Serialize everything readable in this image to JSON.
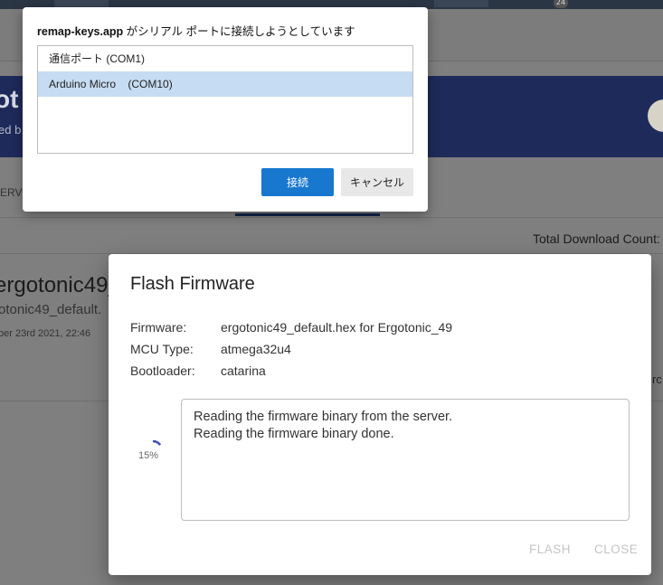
{
  "background": {
    "notification_count": "24",
    "banner_title_fragment": "ot",
    "banner_sub_fragment": "ed b",
    "tab_fragment": "ERV",
    "total_download_label": "Total Download Count:",
    "card_title": "ergotonic49_d",
    "card_subtitle": "otonic49_default.",
    "card_date": "ber 23rd 2021, 22:46",
    "right_fragment": "rc"
  },
  "flash_dialog": {
    "title": "Flash Firmware",
    "fields": [
      {
        "label": "Firmware:",
        "value": "ergotonic49_default.hex for Ergotonic_49"
      },
      {
        "label": "MCU Type:",
        "value": "atmega32u4"
      },
      {
        "label": "Bootloader:",
        "value": "catarina"
      }
    ],
    "progress": {
      "percent_label": "15%",
      "value": 0.15
    },
    "log_lines": [
      "Reading the firmware binary from the server.",
      "Reading the firmware binary done."
    ],
    "buttons": {
      "flash": "FLASH",
      "close": "CLOSE"
    }
  },
  "serial_chooser": {
    "site": "remap-keys.app",
    "message": " がシリアル ポートに接続しようとしています",
    "ports": [
      {
        "label": "通信ポート (COM1)",
        "selected": false
      },
      {
        "label": "Arduino Micro    (COM10)",
        "selected": true
      }
    ],
    "connect_label": "接続",
    "cancel_label": "キャンセル",
    "selected_color": "#c6dcf2",
    "primary_color": "#1877cf"
  }
}
